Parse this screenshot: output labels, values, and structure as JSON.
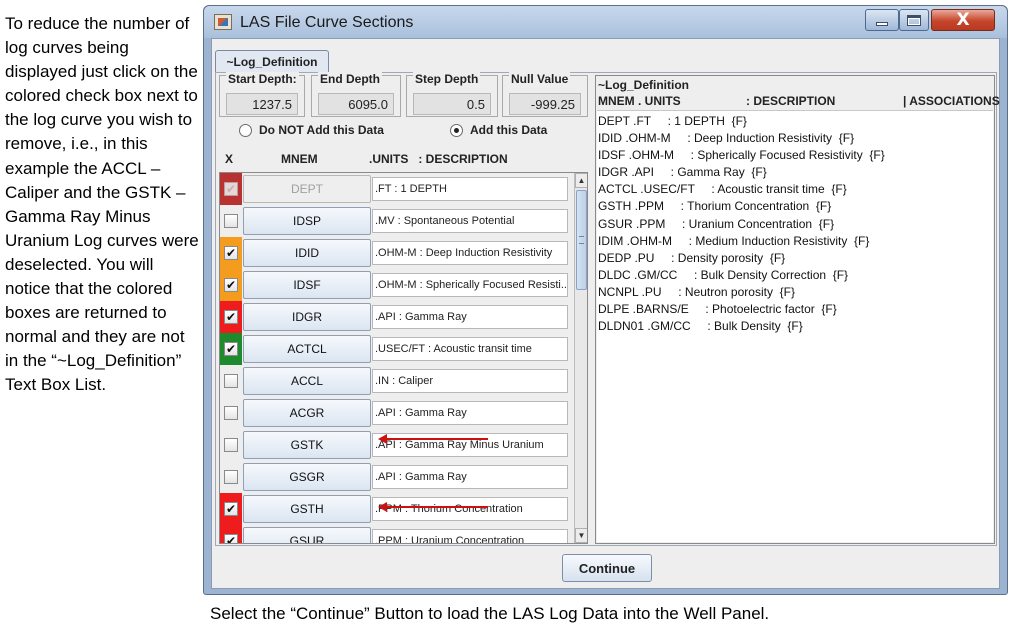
{
  "side_note": "To reduce the number of log curves being displayed just click on the colored check box next to the log curve you wish to remove, i.e., in this example the ACCL – Caliper and the GSTK – Gamma Ray Minus Uranium Log curves were deselected.  You will notice that the colored boxes are returned to normal and they are not in the “~Log_Definition” Text Box List.",
  "bottom_note": "Select the “Continue” Button to load the LAS Log Data into the Well Panel.",
  "window": {
    "title": "LAS File Curve Sections",
    "close_glyph": "X"
  },
  "tab": {
    "label": "~Log_Definition"
  },
  "fields": {
    "start_depth": {
      "label": "Start Depth:",
      "value": "1237.5"
    },
    "end_depth": {
      "label": "End Depth",
      "value": "6095.0"
    },
    "step_depth": {
      "label": "Step Depth",
      "value": "0.5"
    },
    "null_value": {
      "label": "Null Value",
      "value": "-999.25"
    }
  },
  "radios": {
    "no_add": {
      "label": "Do NOT Add this Data",
      "selected": false
    },
    "add": {
      "label": "Add this Data",
      "selected": true
    }
  },
  "columns": {
    "x": "X",
    "mnem": "MNEM",
    "units_desc": ".UNITS   : DESCRIPTION"
  },
  "rows": [
    {
      "mnem": "DEPT",
      "desc": ".FT : 1 DEPTH",
      "color": "#b93232",
      "checked": true,
      "disabled": true
    },
    {
      "mnem": "IDSP",
      "desc": ".MV : Spontaneous Potential",
      "color": "#eeeeee",
      "checked": false,
      "disabled": false
    },
    {
      "mnem": "IDID",
      "desc": ".OHM-M : Deep Induction Resistivity",
      "color": "#f39c1e",
      "checked": true,
      "disabled": false
    },
    {
      "mnem": "IDSF",
      "desc": ".OHM-M : Spherically Focused Resisti...",
      "color": "#f39c1e",
      "checked": true,
      "disabled": false
    },
    {
      "mnem": "IDGR",
      "desc": ".API : Gamma Ray",
      "color": "#ee1c1c",
      "checked": true,
      "disabled": false
    },
    {
      "mnem": "ACTCL",
      "desc": ".USEC/FT : Acoustic transit time",
      "color": "#1d8a2e",
      "checked": true,
      "disabled": false
    },
    {
      "mnem": "ACCL",
      "desc": ".IN : Caliper",
      "color": "#eeeeee",
      "checked": false,
      "disabled": false
    },
    {
      "mnem": "ACGR",
      "desc": ".API : Gamma Ray",
      "color": "#eeeeee",
      "checked": false,
      "disabled": false
    },
    {
      "mnem": "GSTK",
      "desc": ".API : Gamma Ray Minus Uranium",
      "color": "#eeeeee",
      "checked": false,
      "disabled": false
    },
    {
      "mnem": "GSGR",
      "desc": ".API : Gamma Ray",
      "color": "#eeeeee",
      "checked": false,
      "disabled": false
    },
    {
      "mnem": "GSTH",
      "desc": ".PPM : Thorium Concentration",
      "color": "#ee1c1c",
      "checked": true,
      "disabled": false
    },
    {
      "mnem": "GSUR",
      "desc": ".PPM : Uranium Concentration",
      "color": "#ee1c1c",
      "checked": true,
      "disabled": false
    }
  ],
  "scroll": {
    "up": "▲",
    "down": "▼"
  },
  "text_panel": {
    "title": "~Log_Definition",
    "header_mnem_units": "MNEM . UNITS",
    "header_description": ": DESCRIPTION",
    "header_associations": "| ASSOCIATIONS",
    "lines": [
      "DEPT .FT     : 1 DEPTH  {F}",
      "IDID .OHM-M     : Deep Induction Resistivity  {F}",
      "IDSF .OHM-M     : Spherically Focused Resistivity  {F}",
      "IDGR .API     : Gamma Ray  {F}",
      "ACTCL .USEC/FT     : Acoustic transit time  {F}",
      "GSTH .PPM     : Thorium Concentration  {F}",
      "GSUR .PPM     : Uranium Concentration  {F}",
      "IDIM .OHM-M     : Medium Induction Resistivity  {F}",
      "DEDP .PU     : Density porosity  {F}",
      "DLDC .GM/CC     : Bulk Density Correction  {F}",
      "NCNPL .PU     : Neutron porosity  {F}",
      "DLPE .BARNS/E     : Photoelectric factor  {F}",
      "DLDN01 .GM/CC     : Bulk Density  {F}"
    ]
  },
  "continue_button": {
    "label": "Continue"
  }
}
